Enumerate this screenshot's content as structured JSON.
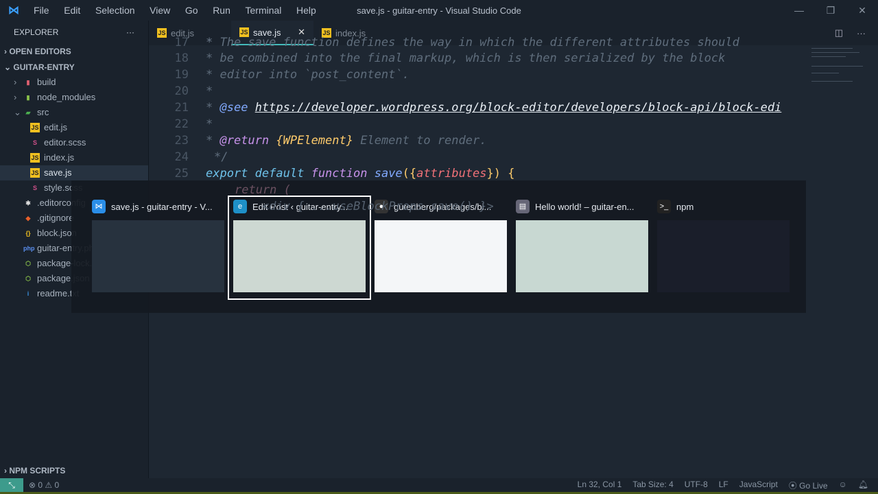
{
  "window": {
    "title": "save.js - guitar-entry - Visual Studio Code",
    "menu": [
      "File",
      "Edit",
      "Selection",
      "View",
      "Go",
      "Run",
      "Terminal",
      "Help"
    ]
  },
  "sidebar": {
    "title": "EXPLORER",
    "more": "···",
    "open_editors": "OPEN EDITORS",
    "project": "GUITAR-ENTRY",
    "npm_scripts": "NPM SCRIPTS",
    "items": [
      {
        "label": "build",
        "icon": "folder-icon",
        "indent": 1,
        "color": "#e06070"
      },
      {
        "label": "node_modules",
        "icon": "folder-icon",
        "indent": 1,
        "color": "#8bc34a"
      },
      {
        "label": "src",
        "icon": "folder-open-icon",
        "indent": 1,
        "color": "#4caf50"
      },
      {
        "label": "edit.js",
        "icon": "js-file-icon",
        "indent": 2
      },
      {
        "label": "editor.scss",
        "icon": "sass-file-icon",
        "indent": 2
      },
      {
        "label": "index.js",
        "icon": "js-file-icon",
        "indent": 2
      },
      {
        "label": "save.js",
        "icon": "js-file-icon",
        "indent": 2,
        "active": true
      },
      {
        "label": "style.scss",
        "icon": "sass-file-icon",
        "indent": 2
      },
      {
        "label": ".editorconfig",
        "icon": "config-file-icon",
        "indent": 1
      },
      {
        "label": ".gitignore",
        "icon": "git-file-icon",
        "indent": 1
      },
      {
        "label": "block.json",
        "icon": "json-file-icon",
        "indent": 1
      },
      {
        "label": "guitar-entry.php",
        "icon": "php-file-icon",
        "indent": 1
      },
      {
        "label": "package-lock.json",
        "icon": "npm-file-icon",
        "indent": 1
      },
      {
        "label": "package.json",
        "icon": "npm-file-icon",
        "indent": 1
      },
      {
        "label": "readme.txt",
        "icon": "info-file-icon",
        "indent": 1
      }
    ]
  },
  "tabs": [
    {
      "label": "edit.js"
    },
    {
      "label": "save.js",
      "active": true
    },
    {
      "label": "index.js"
    }
  ],
  "code": {
    "l17": "The save function defines the way in which the different attributes should",
    "l18": "* be combined into the final markup, which is then serialized by the block",
    "l19": "* editor into `post_content`.",
    "l20": "*",
    "l21_tag": "@see",
    "l21_url": "https://developer.wordpress.org/block-editor/developers/block-api/block-edi",
    "l22": "*",
    "l23_tag": "@return",
    "l23_type": "{WPElement}",
    "l23_desc": "Element to render.",
    "l24": "*/",
    "l25_export": "export",
    "l25_default": "default",
    "l25_function": "function",
    "l25_name": "save",
    "l25_param": "attributes",
    "l26": "return (",
    "l27": "<div { ...useBlockProps.save() }>"
  },
  "switcher": [
    {
      "title": "save.js - guitar-entry - V...",
      "icon": "vscode-icon"
    },
    {
      "title": "Edit Post ‹ guitar-entry...",
      "icon": "edge-icon",
      "selected": true
    },
    {
      "title": "gutenberg/packages/bl...",
      "icon": "github-icon"
    },
    {
      "title": "Hello world! – guitar-en...",
      "icon": "page-icon"
    },
    {
      "title": "npm",
      "icon": "terminal-icon"
    }
  ],
  "status": {
    "errors": "0",
    "warnings": "0",
    "position": "Ln 32, Col 1",
    "tab_size": "Tab Size: 4",
    "encoding": "UTF-8",
    "eol": "LF",
    "language": "JavaScript",
    "go_live": "Go Live"
  }
}
